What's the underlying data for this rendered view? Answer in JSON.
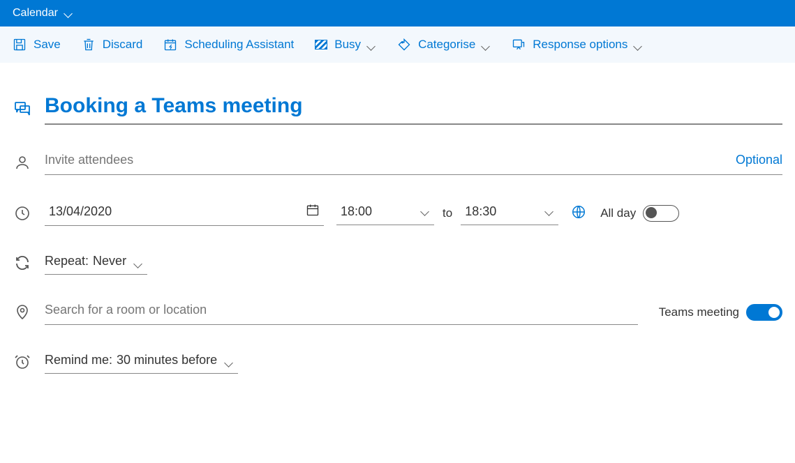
{
  "titlebar": {
    "label": "Calendar"
  },
  "toolbar": {
    "save": "Save",
    "discard": "Discard",
    "scheduling": "Scheduling Assistant",
    "busy": "Busy",
    "categorise": "Categorise",
    "response": "Response options"
  },
  "form": {
    "title": "Booking a Teams meeting",
    "attendees_placeholder": "Invite attendees",
    "optional": "Optional",
    "date": "13/04/2020",
    "start_time": "18:00",
    "to_label": "to",
    "end_time": "18:30",
    "all_day_label": "All day",
    "all_day_on": false,
    "repeat_label": "Repeat:",
    "repeat_value": "Never",
    "location_placeholder": "Search for a room or location",
    "teams_label": "Teams meeting",
    "teams_on": true,
    "remind_label": "Remind me:",
    "remind_value": "30 minutes before"
  }
}
